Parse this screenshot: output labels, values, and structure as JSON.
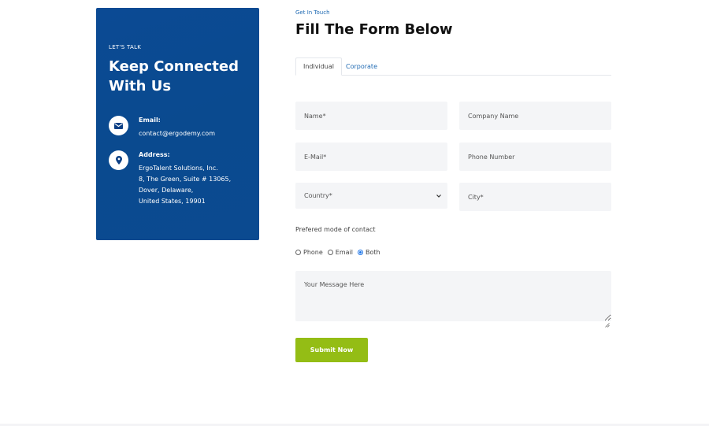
{
  "contact_card": {
    "eyebrow": "LET'S TALK",
    "headline": "Keep Connected With Us",
    "email": {
      "icon": "envelope-icon",
      "label": "Email:",
      "value": "contact@ergodemy.com"
    },
    "address": {
      "icon": "map-pin-icon",
      "label": "Address:",
      "lines": [
        "ErgoTalent Solutions, Inc.",
        "8, The Green, Suite # 13065,",
        "Dover, Delaware,",
        "United States, 19901"
      ]
    }
  },
  "form_section": {
    "eyebrow": "Get In Touch",
    "title": "Fill The Form Below",
    "tabs": [
      {
        "label": "Individual",
        "active": true
      },
      {
        "label": "Corporate",
        "active": false
      }
    ],
    "fields": {
      "name": {
        "placeholder": "Name*",
        "value": ""
      },
      "company": {
        "placeholder": "Company Name",
        "value": ""
      },
      "email": {
        "placeholder": "E-Mail*",
        "value": ""
      },
      "phone": {
        "placeholder": "Phone Number",
        "value": ""
      },
      "country": {
        "selected": "Country*"
      },
      "city": {
        "placeholder": "City*",
        "value": ""
      }
    },
    "preferred_contact": {
      "label": "Prefered mode of contact",
      "options": [
        {
          "label": "Phone",
          "checked": false
        },
        {
          "label": "Email",
          "checked": false
        },
        {
          "label": "Both",
          "checked": true
        }
      ]
    },
    "message": {
      "placeholder": "Your Message Here",
      "value": ""
    },
    "submit_label": "Submit Now"
  },
  "colors": {
    "card_blue": "#0b4a90",
    "link_blue": "#1f6ab3",
    "submit_green": "#94bd15",
    "field_bg": "#f4f5f7"
  }
}
